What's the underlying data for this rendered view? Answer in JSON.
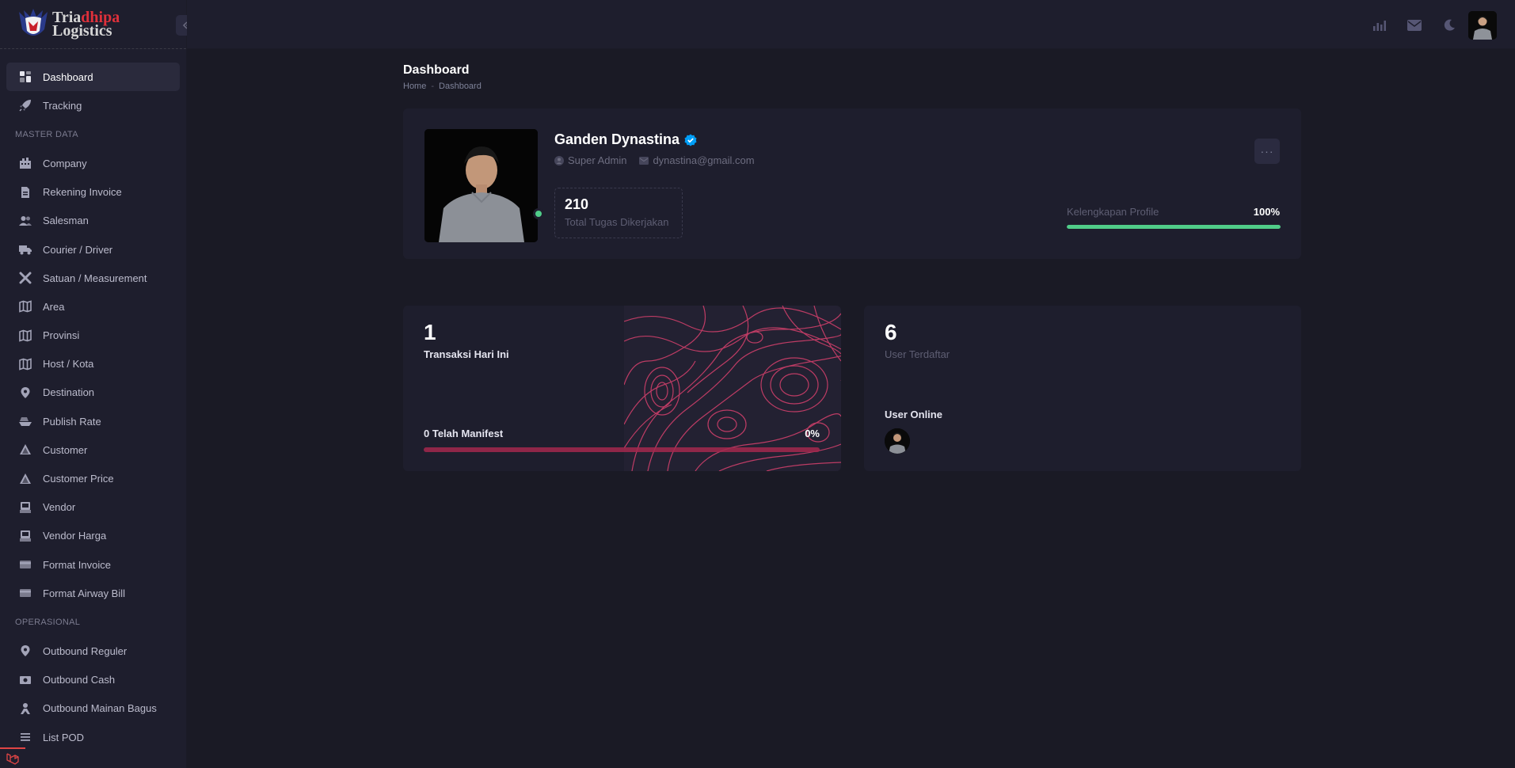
{
  "brand": {
    "line1_a": "Tria",
    "line1_b": "dhipa",
    "line2": "Logistics",
    "accent": "#e0303a"
  },
  "sidebar": {
    "items": [
      {
        "label": "Dashboard",
        "icon": "grid-icon",
        "active": true
      },
      {
        "label": "Tracking",
        "icon": "rocket-icon"
      }
    ],
    "section_master": "MASTER DATA",
    "master_items": [
      {
        "label": "Company",
        "icon": "building-icon"
      },
      {
        "label": "Rekening Invoice",
        "icon": "file-icon"
      },
      {
        "label": "Salesman",
        "icon": "users-icon"
      },
      {
        "label": "Courier / Driver",
        "icon": "truck-icon"
      },
      {
        "label": "Satuan / Measurement",
        "icon": "tools-icon"
      },
      {
        "label": "Area",
        "icon": "map-icon"
      },
      {
        "label": "Provinsi",
        "icon": "map-icon"
      },
      {
        "label": "Host / Kota",
        "icon": "map-icon"
      },
      {
        "label": "Destination",
        "icon": "pin-icon"
      },
      {
        "label": "Publish Rate",
        "icon": "boat-icon"
      },
      {
        "label": "Customer",
        "icon": "triangle-icon"
      },
      {
        "label": "Customer Price",
        "icon": "triangle-icon"
      },
      {
        "label": "Vendor",
        "icon": "printer-icon"
      },
      {
        "label": "Vendor Harga",
        "icon": "printer-icon"
      },
      {
        "label": "Format Invoice",
        "icon": "card-icon"
      },
      {
        "label": "Format Airway Bill",
        "icon": "card-icon"
      }
    ],
    "section_ops": "OPERASIONAL",
    "ops_items": [
      {
        "label": "Outbound Reguler",
        "icon": "pin-icon"
      },
      {
        "label": "Outbound Cash",
        "icon": "money-icon"
      },
      {
        "label": "Outbound Mainan Bagus",
        "icon": "person-icon"
      },
      {
        "label": "List POD",
        "icon": "list-icon"
      }
    ]
  },
  "page": {
    "title": "Dashboard",
    "breadcrumb": [
      "Home",
      "Dashboard"
    ]
  },
  "profile": {
    "name": "Ganden Dynastina",
    "role": "Super Admin",
    "email": "dynastina@gmail.com",
    "task_count": "210",
    "task_label": "Total Tugas Dikerjakan",
    "completion_label": "Kelengkapan Profile",
    "completion_pct": "100%",
    "completion_value": 1.0
  },
  "transactions": {
    "count": "1",
    "label": "Transaksi Hari Ini",
    "manifest_label": "0 Telah Manifest",
    "manifest_pct": "0%"
  },
  "users": {
    "count": "6",
    "label": "User Terdaftar",
    "online_label": "User Online"
  },
  "colors": {
    "bg": "#1a1a25",
    "card": "#1e1e2d",
    "success": "#50cd89",
    "danger_bar": "#a3284e",
    "verified": "#009ef7"
  }
}
